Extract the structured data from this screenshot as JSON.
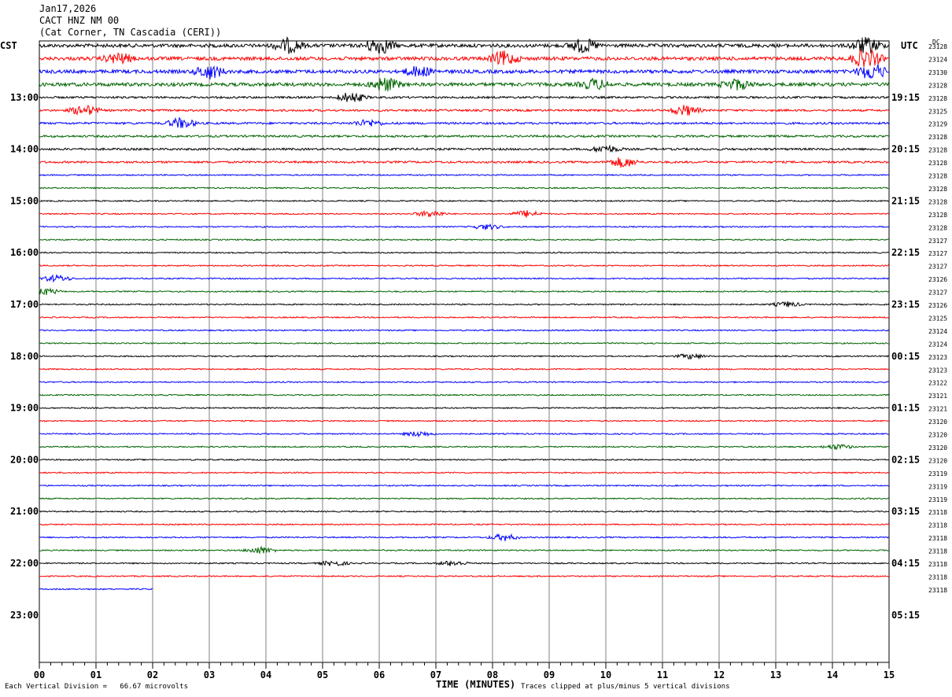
{
  "header": {
    "date": "Jan17,2026",
    "station": "CACT HNZ NM 00",
    "location": "(Cat Corner, TN Cascadia (CERI))"
  },
  "left_axis_label": "CST",
  "right_axis_label": "UTC",
  "dc_label": "DC",
  "x_axis_title": "TIME (MINUTES)",
  "footer": {
    "scale_note": "Each Vertical Division =   66.67 microvolts",
    "clip_note": "Traces clipped at plus/minus 5 vertical divisions"
  },
  "colors": {
    "trace_cycle": [
      "#000000",
      "#ff0000",
      "#0000ff",
      "#006400"
    ],
    "grid": "#808080"
  },
  "chart_data": {
    "type": "line",
    "x_ticks": [
      "00",
      "01",
      "02",
      "03",
      "04",
      "05",
      "06",
      "07",
      "08",
      "09",
      "10",
      "11",
      "12",
      "13",
      "14",
      "15"
    ],
    "xlim": [
      0,
      15
    ],
    "left_time_labels": [
      "13:00",
      "14:00",
      "15:00",
      "16:00",
      "17:00",
      "18:00",
      "19:00",
      "20:00",
      "21:00",
      "22:00",
      "23:00"
    ],
    "right_time_labels": [
      "19:15",
      "20:15",
      "21:15",
      "22:15",
      "23:15",
      "00:15",
      "01:15",
      "02:15",
      "03:15",
      "04:15",
      "05:15"
    ],
    "dc_offsets": [
      "23128",
      "23124",
      "23130",
      "23128",
      "23128",
      "23125",
      "23129",
      "23128",
      "23128",
      "23128",
      "23128",
      "23128",
      "23128",
      "23128",
      "23128",
      "23127",
      "23127",
      "23127",
      "23126",
      "23127",
      "23126",
      "23125",
      "23124",
      "23124",
      "23123",
      "23123",
      "23122",
      "23121",
      "23121",
      "23120",
      "23120",
      "23120",
      "23120",
      "23119",
      "23119",
      "23119",
      "23118",
      "23118",
      "23118",
      "23118",
      "23118",
      "23118",
      "23118"
    ],
    "trace_count": 43,
    "partial_last_trace_minutes": 2,
    "events": [
      {
        "trace": 0,
        "minute": 4.4,
        "amp": 4
      },
      {
        "trace": 0,
        "minute": 6.0,
        "amp": 5
      },
      {
        "trace": 0,
        "minute": 9.6,
        "amp": 4
      },
      {
        "trace": 0,
        "minute": 14.6,
        "amp": 5
      },
      {
        "trace": 1,
        "minute": 1.4,
        "amp": 3
      },
      {
        "trace": 1,
        "minute": 8.2,
        "amp": 4
      },
      {
        "trace": 1,
        "minute": 14.6,
        "amp": 6
      },
      {
        "trace": 2,
        "minute": 3.0,
        "amp": 4
      },
      {
        "trace": 2,
        "minute": 6.7,
        "amp": 3
      },
      {
        "trace": 2,
        "minute": 14.7,
        "amp": 5
      },
      {
        "trace": 3,
        "minute": 6.1,
        "amp": 4
      },
      {
        "trace": 3,
        "minute": 9.8,
        "amp": 3
      },
      {
        "trace": 3,
        "minute": 12.3,
        "amp": 3
      },
      {
        "trace": 4,
        "minute": 5.5,
        "amp": 3
      },
      {
        "trace": 5,
        "minute": 0.8,
        "amp": 3
      },
      {
        "trace": 5,
        "minute": 11.4,
        "amp": 3
      },
      {
        "trace": 6,
        "minute": 2.5,
        "amp": 3
      },
      {
        "trace": 6,
        "minute": 5.8,
        "amp": 2
      },
      {
        "trace": 8,
        "minute": 10.0,
        "amp": 2
      },
      {
        "trace": 9,
        "minute": 10.3,
        "amp": 3
      },
      {
        "trace": 13,
        "minute": 6.9,
        "amp": 2
      },
      {
        "trace": 13,
        "minute": 8.6,
        "amp": 2
      },
      {
        "trace": 14,
        "minute": 7.9,
        "amp": 1.5
      },
      {
        "trace": 18,
        "minute": 0.3,
        "amp": 2
      },
      {
        "trace": 19,
        "minute": 0.1,
        "amp": 2
      },
      {
        "trace": 20,
        "minute": 13.2,
        "amp": 1.5
      },
      {
        "trace": 24,
        "minute": 11.5,
        "amp": 1.5
      },
      {
        "trace": 30,
        "minute": 6.7,
        "amp": 1.5
      },
      {
        "trace": 31,
        "minute": 14.1,
        "amp": 1.5
      },
      {
        "trace": 38,
        "minute": 8.2,
        "amp": 2
      },
      {
        "trace": 39,
        "minute": 3.9,
        "amp": 2
      },
      {
        "trace": 40,
        "minute": 5.2,
        "amp": 1.5
      },
      {
        "trace": 40,
        "minute": 7.3,
        "amp": 1.5
      }
    ]
  }
}
